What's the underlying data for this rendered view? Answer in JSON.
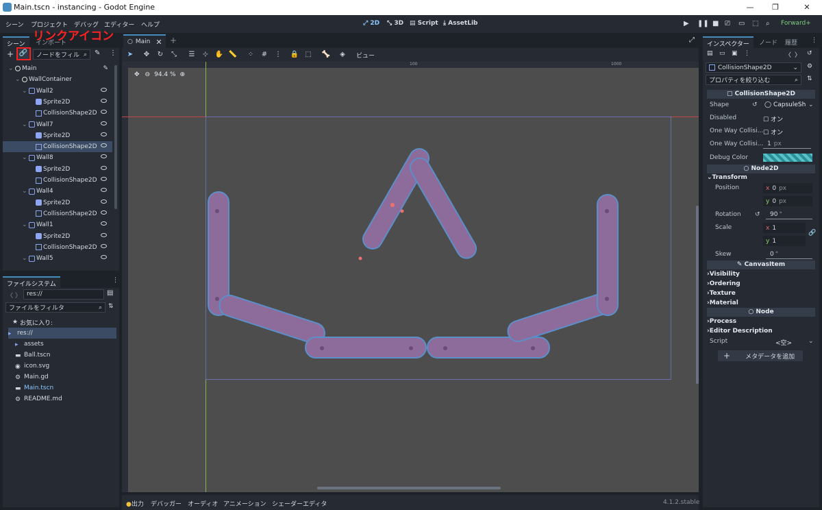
{
  "window": {
    "title": "Main.tscn - instancing - Godot Engine",
    "minimize": "—",
    "maximize": "❐",
    "close": "✕"
  },
  "menu": [
    "シーン",
    "プロジェクト",
    "デバッグ",
    "エディター",
    "ヘルプ"
  ],
  "workspaces": [
    "2D",
    "3D",
    "Script",
    "AssetLib"
  ],
  "renderer": "Forward+",
  "annotation": "リンクアイコン",
  "scene_dock": {
    "tabs": [
      "シーン",
      "インポート"
    ],
    "filter_placeholder": "ノードをフィル",
    "nodes": [
      {
        "label": "Main",
        "type": "root",
        "indent": 0
      },
      {
        "label": "WallContainer",
        "type": "root",
        "indent": 1
      },
      {
        "label": "Wall2",
        "type": "wall",
        "indent": 2
      },
      {
        "label": "Sprite2D",
        "type": "sprite",
        "indent": 3
      },
      {
        "label": "CollisionShape2D",
        "type": "coll",
        "indent": 3
      },
      {
        "label": "Wall7",
        "type": "wall",
        "indent": 2
      },
      {
        "label": "Sprite2D",
        "type": "sprite",
        "indent": 3
      },
      {
        "label": "CollisionShape2D",
        "type": "coll",
        "indent": 3,
        "selected": true
      },
      {
        "label": "Wall8",
        "type": "wall",
        "indent": 2
      },
      {
        "label": "Sprite2D",
        "type": "sprite",
        "indent": 3
      },
      {
        "label": "CollisionShape2D",
        "type": "coll",
        "indent": 3
      },
      {
        "label": "Wall4",
        "type": "wall",
        "indent": 2
      },
      {
        "label": "Sprite2D",
        "type": "sprite",
        "indent": 3
      },
      {
        "label": "CollisionShape2D",
        "type": "coll",
        "indent": 3
      },
      {
        "label": "Wall1",
        "type": "wall",
        "indent": 2
      },
      {
        "label": "Sprite2D",
        "type": "sprite",
        "indent": 3
      },
      {
        "label": "CollisionShape2D",
        "type": "coll",
        "indent": 3
      },
      {
        "label": "Wall5",
        "type": "wall",
        "indent": 2
      }
    ]
  },
  "filesystem": {
    "tab": "ファイルシステム",
    "path": "res://",
    "filter_placeholder": "ファイルをフィルタ",
    "favorites": "お気に入り:",
    "items": [
      {
        "label": "res://",
        "type": "folder-open"
      },
      {
        "label": "assets",
        "type": "folder"
      },
      {
        "label": "Ball.tscn",
        "type": "scene"
      },
      {
        "label": "icon.svg",
        "type": "image"
      },
      {
        "label": "Main.gd",
        "type": "script"
      },
      {
        "label": "Main.tscn",
        "type": "scene",
        "active": true
      },
      {
        "label": "README.md",
        "type": "doc"
      }
    ]
  },
  "editor": {
    "tab": "Main",
    "zoom": "94.4 %",
    "view_menu": "ビュー",
    "ruler_marks": [
      "100",
      "1000"
    ]
  },
  "bottom_panel": {
    "tabs": [
      "出力",
      "デバッガー",
      "オーディオ",
      "アニメーション",
      "シェーダーエディタ"
    ],
    "version": "4.1.2.stable"
  },
  "inspector": {
    "tabs": [
      "インスペクター",
      "ノード",
      "履歴"
    ],
    "node_selector": "CollisionShape2D",
    "filter_placeholder": "プロパティを絞り込む",
    "section_main": "CollisionShape2D",
    "props": {
      "shape_label": "Shape",
      "shape_value": "CapsuleSh",
      "disabled_label": "Disabled",
      "disabled_value": "オン",
      "oneway_label": "One Way Collisi...",
      "oneway_value": "オン",
      "onewaymargin_label": "One Way Collisi...",
      "onewaymargin_value": "1",
      "onewaymargin_unit": "px",
      "debugcolor_label": "Debug Color"
    },
    "section_node2d": "Node2D",
    "transform": "Transform",
    "position_label": "Position",
    "pos_x": "0",
    "pos_y": "0",
    "pos_unit": "px",
    "rotation_label": "Rotation",
    "rotation_value": "90",
    "rotation_unit": "°",
    "scale_label": "Scale",
    "scale_x": "1",
    "scale_y": "1",
    "skew_label": "Skew",
    "skew_value": "0",
    "skew_unit": "°",
    "section_canvas": "CanvasItem",
    "canvas_subs": [
      "Visibility",
      "Ordering",
      "Texture",
      "Material"
    ],
    "section_node": "Node",
    "node_subs": [
      "Process",
      "Editor Description"
    ],
    "script_label": "Script",
    "script_value": "<空>",
    "add_meta": "メタデータを追加"
  },
  "colors": {
    "accent": "#478cbf",
    "selected": "#3a4b63",
    "wall": "#8d6b9a",
    "annotation_red": "#ff2222"
  }
}
